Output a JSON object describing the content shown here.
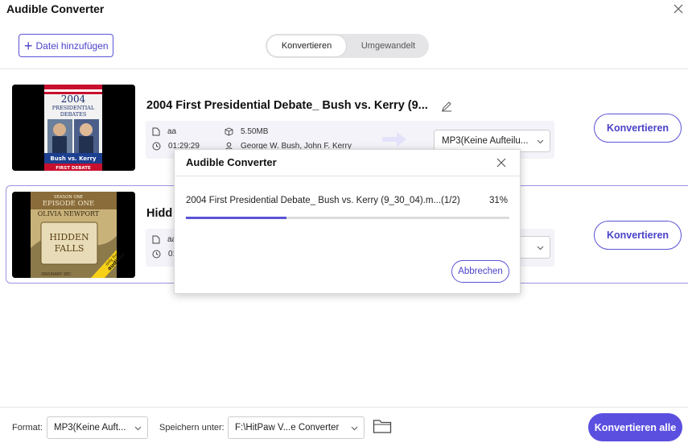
{
  "window": {
    "title": "Audible Converter"
  },
  "toolbar": {
    "add_label": "Datei hinzufügen"
  },
  "tabs": [
    {
      "label": "Konvertieren",
      "active": true
    },
    {
      "label": "Umgewandelt",
      "active": false
    }
  ],
  "items": [
    {
      "title": "2004 First Presidential Debate_ Bush vs. Kerry (9...",
      "author": "aa",
      "size": "5.50MB",
      "duration": "01:29:29",
      "narrator": "George W. Bush, John F. Kerry",
      "format": "MP3(Keine Aufteilu...",
      "convert_label": "Konvertieren",
      "cover": {
        "line1": "2004",
        "line2": "PRESIDENTIAL",
        "line3": "DEBATES",
        "line4": "Bush vs. Kerry",
        "line5": "FIRST DEBATE"
      }
    },
    {
      "title": "Hidd",
      "author": "aa",
      "duration": "01",
      "convert_label": "Konvertieren",
      "cover": {
        "line1": "SEASON ONE",
        "line2": "EPISODE ONE",
        "line3": "OLIVIA NEWPORT",
        "line4": "HIDDEN",
        "line5": "FALLS",
        "line6": "ORDINARY SEC",
        "badge1": "only from",
        "badge2": "audible"
      }
    }
  ],
  "footer": {
    "format_label": "Format:",
    "format_value": "MP3(Keine Auft...",
    "save_label": "Speichern unter:",
    "save_value": "F:\\HitPaw V...e Converter",
    "convert_all_label": "Konvertieren alle"
  },
  "dialog": {
    "title": "Audible Converter",
    "file_text": "2004 First Presidential Debate_ Bush vs. Kerry (9_30_04).m...(1/2)",
    "percent_text": "31%",
    "progress": 0.31,
    "cancel_label": "Abbrechen"
  },
  "colors": {
    "accent": "#5b53d6",
    "accent_fill": "#5b4fe0"
  }
}
